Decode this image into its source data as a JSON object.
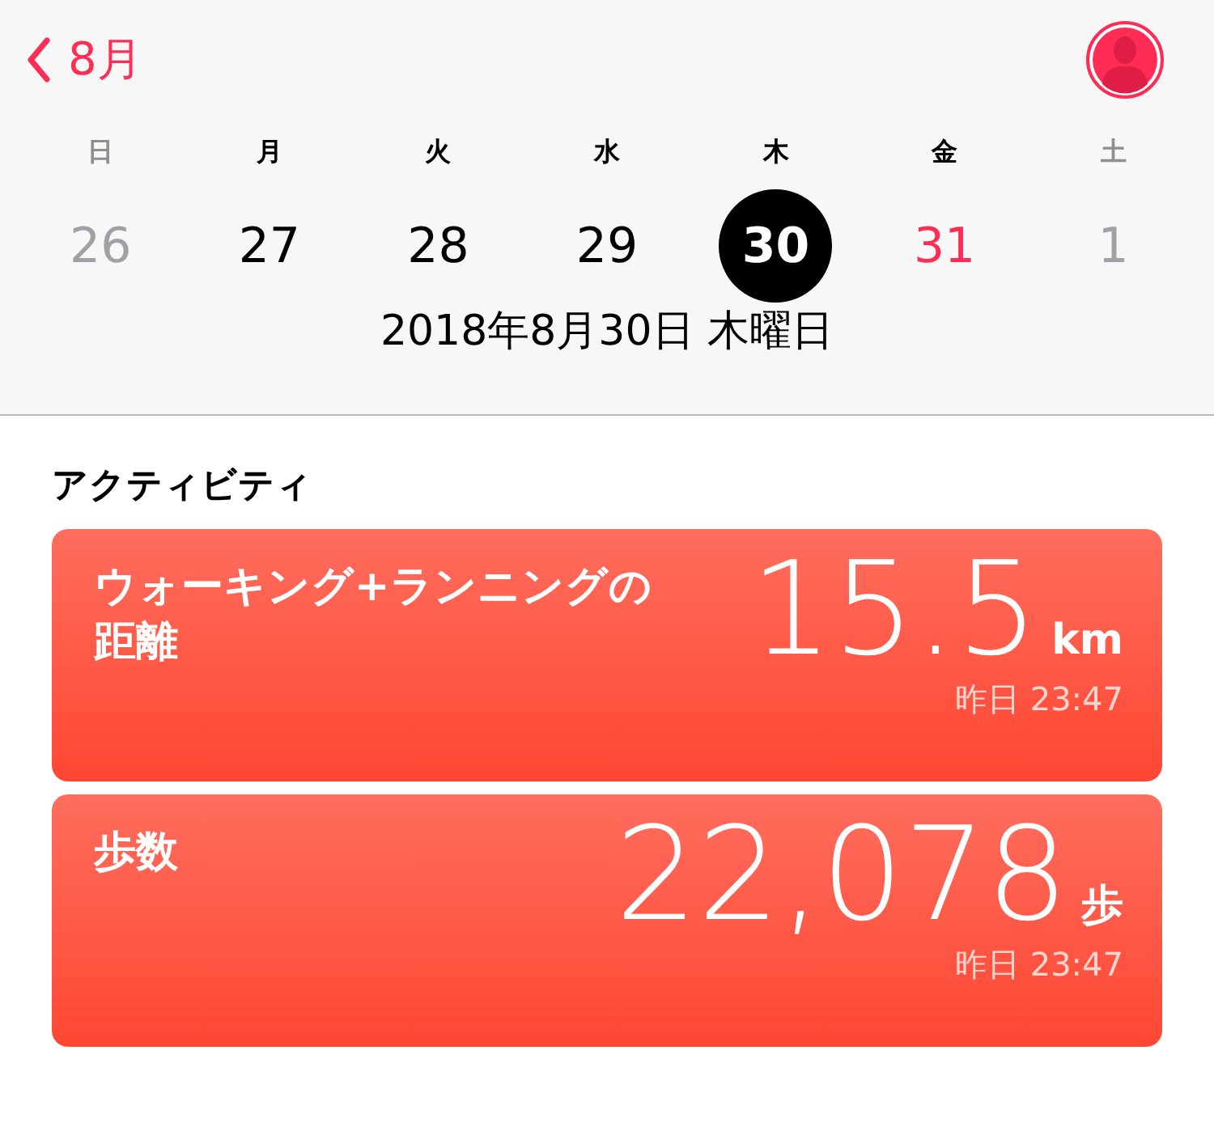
{
  "nav": {
    "back_label": "8月"
  },
  "weekdays": [
    {
      "label": "日",
      "muted": true
    },
    {
      "label": "月",
      "muted": false
    },
    {
      "label": "火",
      "muted": false
    },
    {
      "label": "水",
      "muted": false
    },
    {
      "label": "木",
      "muted": false
    },
    {
      "label": "金",
      "muted": false
    },
    {
      "label": "土",
      "muted": true
    }
  ],
  "days": [
    {
      "label": "26",
      "kind": "muted",
      "selected": false
    },
    {
      "label": "27",
      "kind": "normal",
      "selected": false
    },
    {
      "label": "28",
      "kind": "normal",
      "selected": false
    },
    {
      "label": "29",
      "kind": "normal",
      "selected": false
    },
    {
      "label": "30",
      "kind": "normal",
      "selected": true
    },
    {
      "label": "31",
      "kind": "today",
      "selected": false
    },
    {
      "label": "1",
      "kind": "muted",
      "selected": false
    }
  ],
  "date_title": "2018年8月30日 木曜日",
  "section_title": "アクティビティ",
  "cards": [
    {
      "title": "ウォーキング+ランニングの距離",
      "value": "15.5",
      "unit": "km",
      "time": "昨日 23:47"
    },
    {
      "title": "歩数",
      "value": "22,078",
      "unit": "歩",
      "time": "昨日 23:47"
    }
  ]
}
